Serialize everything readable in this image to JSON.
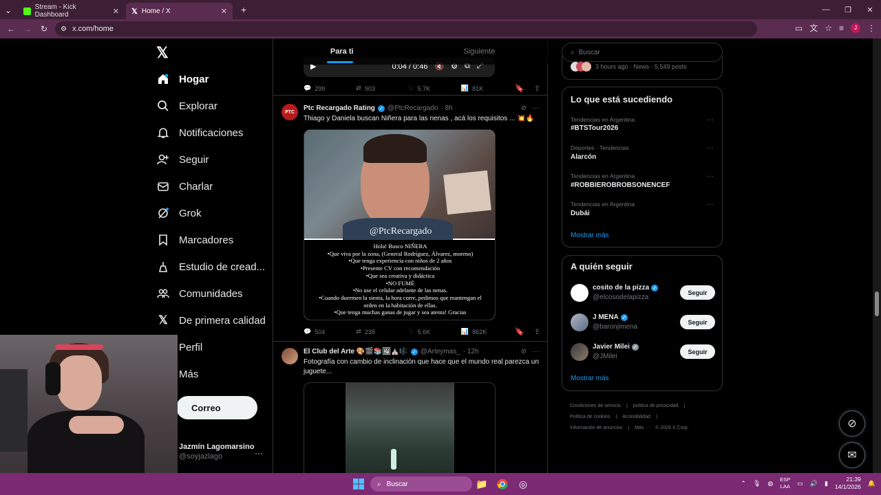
{
  "browser": {
    "tabs": [
      {
        "title": "Stream - Kick Dashboard",
        "favicon_color": "#53fc18"
      },
      {
        "title": "Home / X",
        "favicon_color": "#ffffff"
      }
    ],
    "url": "x.com/home",
    "profile_initial": "J"
  },
  "leftnav": {
    "items": [
      {
        "label": "Hogar",
        "icon": "home-icon"
      },
      {
        "label": "Explorar",
        "icon": "search-icon"
      },
      {
        "label": "Notificaciones",
        "icon": "bell-icon"
      },
      {
        "label": "Seguir",
        "icon": "person-plus-icon"
      },
      {
        "label": "Charlar",
        "icon": "mail-icon"
      },
      {
        "label": "Grok",
        "icon": "grok-icon"
      },
      {
        "label": "Marcadores",
        "icon": "bookmark-icon"
      },
      {
        "label": "Estudio de cread...",
        "icon": "creator-studio-icon"
      },
      {
        "label": "Comunidades",
        "icon": "communities-icon"
      },
      {
        "label": "De primera calidad",
        "icon": "x-premium-icon"
      },
      {
        "label": "Perfil",
        "icon": "person-icon"
      },
      {
        "label": "Más",
        "icon": "more-icon"
      }
    ],
    "post_button": "Correo",
    "profile": {
      "name": "Jazmín Lagomarsino",
      "handle": "@soyjazlago"
    }
  },
  "feed": {
    "tabs": [
      "Para ti",
      "Siguiente"
    ],
    "video_time": "0:04 / 0:46",
    "prev_actions": {
      "replies": "299",
      "reposts": "903",
      "likes": "5.7K",
      "views": "81K"
    },
    "tweets": [
      {
        "name": "Ptc Recargado Rating",
        "handle": "@PtcRecargado",
        "time": "· 8h",
        "text": "Thiago y Daniela buscan Niñera para las nenas , acá los requisitos ... 💥🔥",
        "watermark": "@PtcRecargado",
        "notice_lines": [
          "Hola! Busco NIÑERA",
          "•Que viva por la zona, (General Rodríguez, Álvarez, moreno)",
          "•Que tenga experiencia con niños de 2 años",
          "•Presente CV con recomendación",
          "•Que sea creativa y didáctica",
          "•NO FUMÉ",
          "•No use el celular adelante de las nenas.",
          "•Cuando duermen la sienta, la hora corre, pedimos que mantengan el",
          "orden en la habitación de ellas.",
          "•Que tenga muchas ganas de jugar y sea atenta! Gracias"
        ],
        "actions": {
          "replies": "504",
          "reposts": "238",
          "likes": "5.6K",
          "views": "862K"
        }
      },
      {
        "name": "El Club del Arte 🎨🎬📚🖼⛪🎼",
        "handle": "@Arteymas_",
        "time": "· 12h",
        "text": "Fotografía con cambio de inclinación que hace que el mundo real parezca un juguete..."
      }
    ]
  },
  "sidebar": {
    "search_placeholder": "Buscar",
    "news_meta": "3 hours ago · News · 5,549 posts",
    "trends_title": "Lo que está sucediendo",
    "trends": [
      {
        "meta": "Tendencias en Argentina",
        "name": "#BTSTour2026"
      },
      {
        "meta": "Deportes · Tendencias",
        "name": "Alarcón"
      },
      {
        "meta": "Tendencias en Argentina",
        "name": "#ROBBIEROBROBSONENCEF"
      },
      {
        "meta": "Tendencias en Argentina",
        "name": "Dubái"
      }
    ],
    "show_more": "Mostrar más",
    "follow_title": "A quién seguir",
    "follow": [
      {
        "name": "cosito de la pizza",
        "handle": "@elcosodelapizza",
        "button": "Seguir"
      },
      {
        "name": "J MENA",
        "handle": "@baronjimena",
        "button": "Seguir"
      },
      {
        "name": "Javier Milei",
        "handle": "@JMilei",
        "button": "Seguir"
      }
    ],
    "follow_more": "Mostrar más",
    "footer": [
      "Condiciones de servicio",
      "|",
      "política de privacidad",
      "|",
      "Política de cookies",
      "|",
      "Accesibilidad",
      "|",
      "Información de anuncios",
      "|",
      "Más ···",
      "© 2026 X Corp."
    ]
  },
  "taskbar": {
    "search": "Buscar",
    "lang_top": "ESP",
    "lang_bottom": "LAA",
    "time": "21:39",
    "date": "14/1/2026"
  }
}
